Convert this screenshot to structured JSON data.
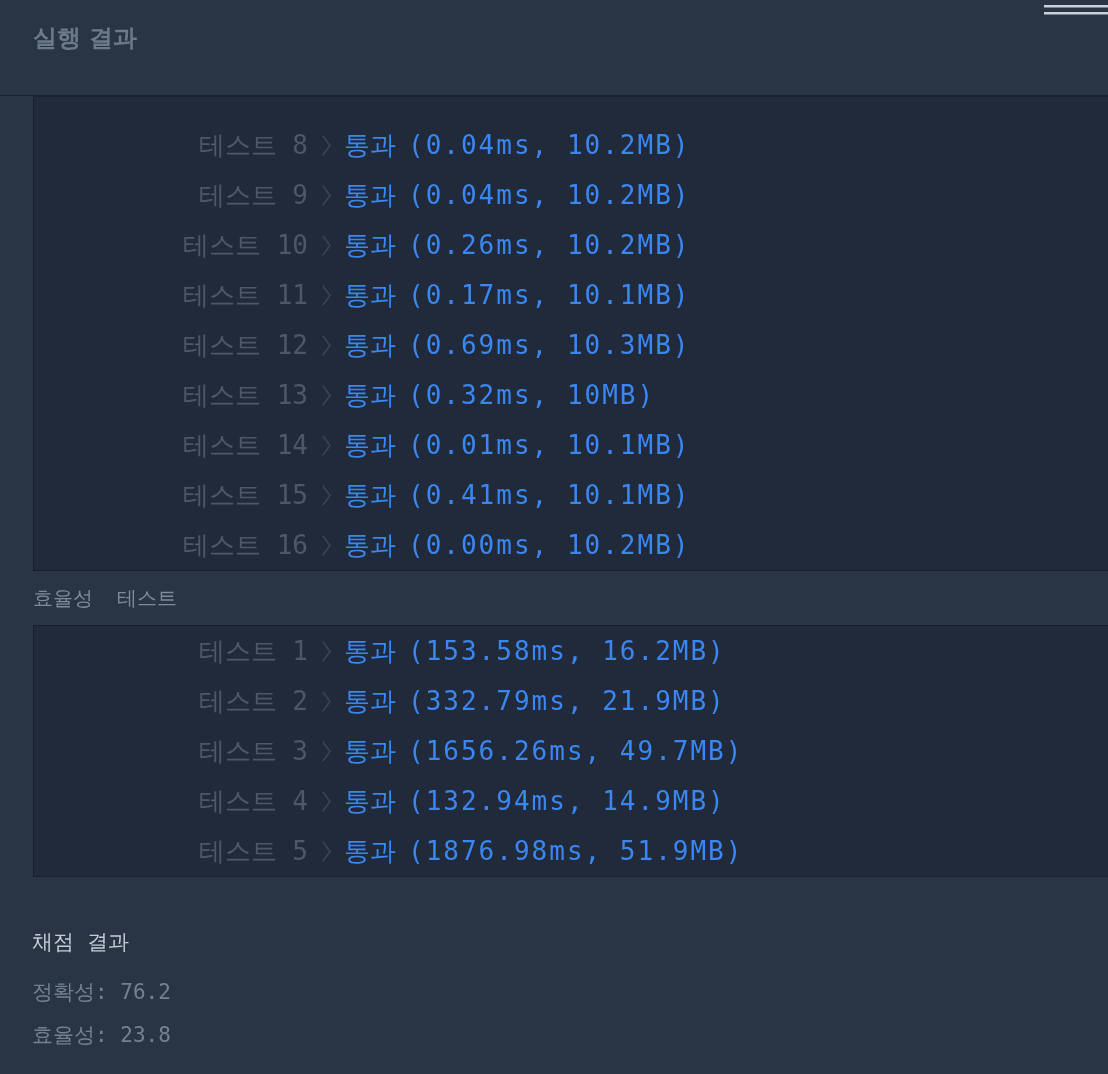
{
  "header": {
    "title": "실행 결과"
  },
  "accuracy_tests": [
    {
      "label": "테스트 8",
      "result": "통과",
      "detail": "(0.04ms, 10.2MB)"
    },
    {
      "label": "테스트 9",
      "result": "통과",
      "detail": "(0.04ms, 10.2MB)"
    },
    {
      "label": "테스트 10",
      "result": "통과",
      "detail": "(0.26ms, 10.2MB)"
    },
    {
      "label": "테스트 11",
      "result": "통과",
      "detail": "(0.17ms, 10.1MB)"
    },
    {
      "label": "테스트 12",
      "result": "통과",
      "detail": "(0.69ms, 10.3MB)"
    },
    {
      "label": "테스트 13",
      "result": "통과",
      "detail": "(0.32ms, 10MB)"
    },
    {
      "label": "테스트 14",
      "result": "통과",
      "detail": "(0.01ms, 10.1MB)"
    },
    {
      "label": "테스트 15",
      "result": "통과",
      "detail": "(0.41ms, 10.1MB)"
    },
    {
      "label": "테스트 16",
      "result": "통과",
      "detail": "(0.00ms, 10.2MB)"
    }
  ],
  "efficiency_heading": "효율성 테스트",
  "efficiency_tests": [
    {
      "label": "테스트 1",
      "result": "통과",
      "detail": "(153.58ms, 16.2MB)"
    },
    {
      "label": "테스트 2",
      "result": "통과",
      "detail": "(332.79ms, 21.9MB)"
    },
    {
      "label": "테스트 3",
      "result": "통과",
      "detail": "(1656.26ms, 49.7MB)"
    },
    {
      "label": "테스트 4",
      "result": "통과",
      "detail": "(132.94ms, 14.9MB)"
    },
    {
      "label": "테스트 5",
      "result": "통과",
      "detail": "(1876.98ms, 51.9MB)"
    }
  ],
  "score": {
    "title": "채점 결과",
    "lines": [
      "정확성: 76.2",
      "효율성: 23.8"
    ]
  }
}
